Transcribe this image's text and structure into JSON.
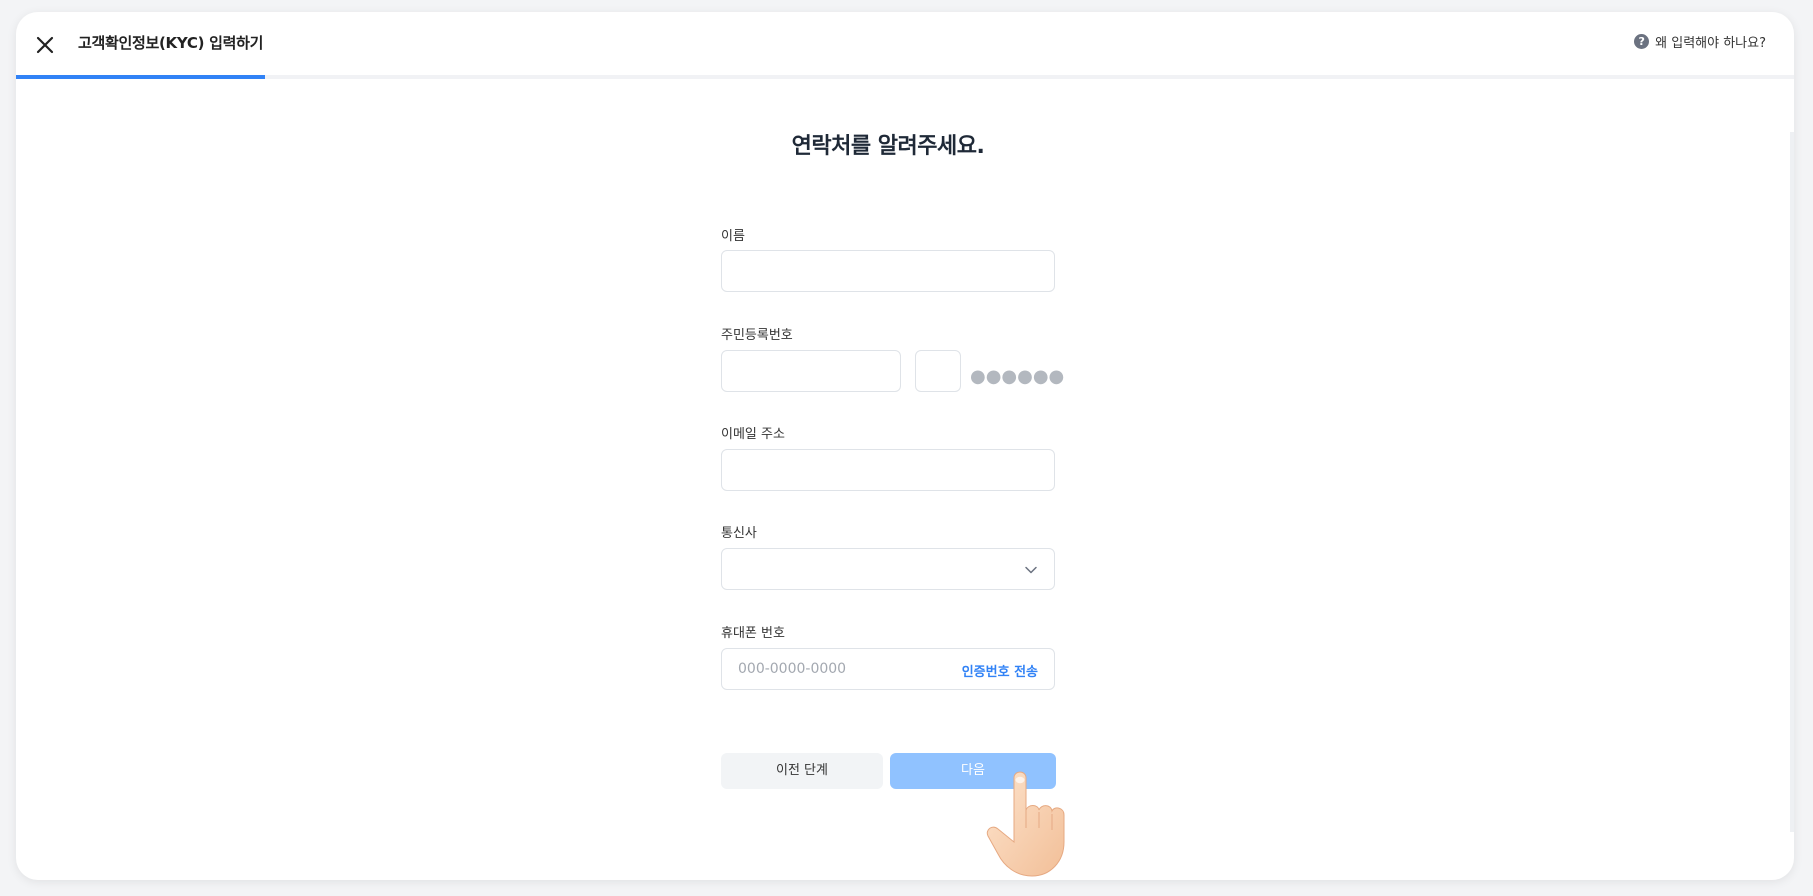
{
  "header": {
    "close_icon": "close-icon",
    "title": "고객확인정보(KYC) 입력하기",
    "help_icon_glyph": "?",
    "help_link": "왜 입력해야 하나요?",
    "progress": 0.14
  },
  "form": {
    "heading": "연락처를 알려주세요.",
    "name_label": "이름",
    "name_value": "",
    "ssn_label": "주민등록번호",
    "ssn_front_value": "",
    "ssn_back_first_value": "",
    "ssn_masked": "●●●●●●",
    "email_label": "이메일 주소",
    "email_value": "",
    "carrier_label": "통신사",
    "carrier_value": "",
    "phone_label": "휴대폰 번호",
    "phone_placeholder": "000-0000-0000",
    "send_code": "인증번호 전송"
  },
  "buttons": {
    "prev": "이전 단계",
    "next": "다음"
  },
  "colors": {
    "accent": "#3182f6",
    "next_button": "#90c2ff",
    "prev_button": "#f2f4f6"
  }
}
